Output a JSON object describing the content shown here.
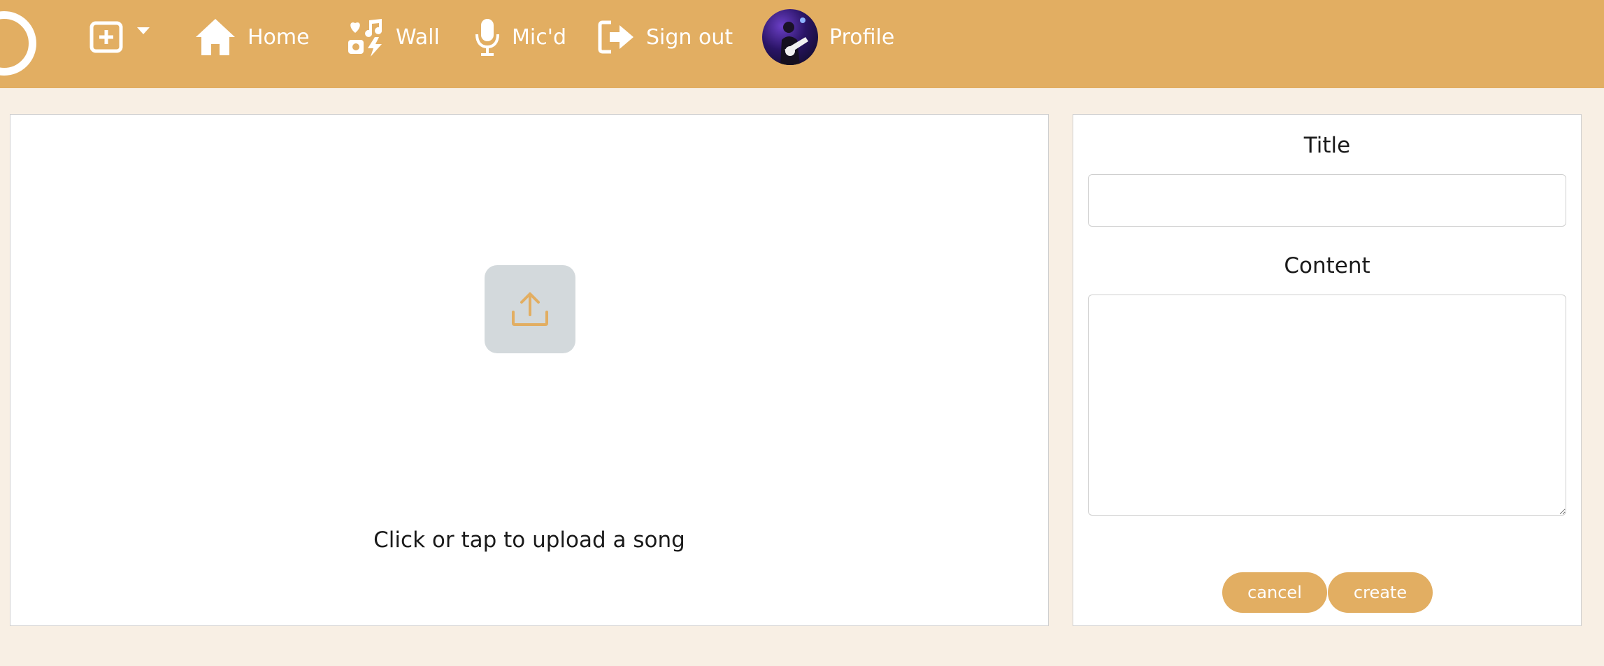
{
  "nav": {
    "create_menu_icon": "plus-square-icon",
    "items": [
      {
        "label": "Home",
        "icon": "home-icon"
      },
      {
        "label": "Wall",
        "icon": "wall-media-icon"
      },
      {
        "label": "Mic'd",
        "icon": "microphone-icon"
      },
      {
        "label": "Sign out",
        "icon": "sign-out-icon"
      },
      {
        "label": "Profile",
        "icon": "avatar"
      }
    ]
  },
  "upload": {
    "icon": "upload-icon",
    "text": "Click or tap to upload a song"
  },
  "form": {
    "title_label": "Title",
    "title_value": "",
    "content_label": "Content",
    "content_value": "",
    "cancel_label": "cancel",
    "create_label": "create"
  },
  "colors": {
    "accent": "#e2ae62",
    "background": "#f8efe4",
    "upload_tile": "#d3d9dc"
  }
}
